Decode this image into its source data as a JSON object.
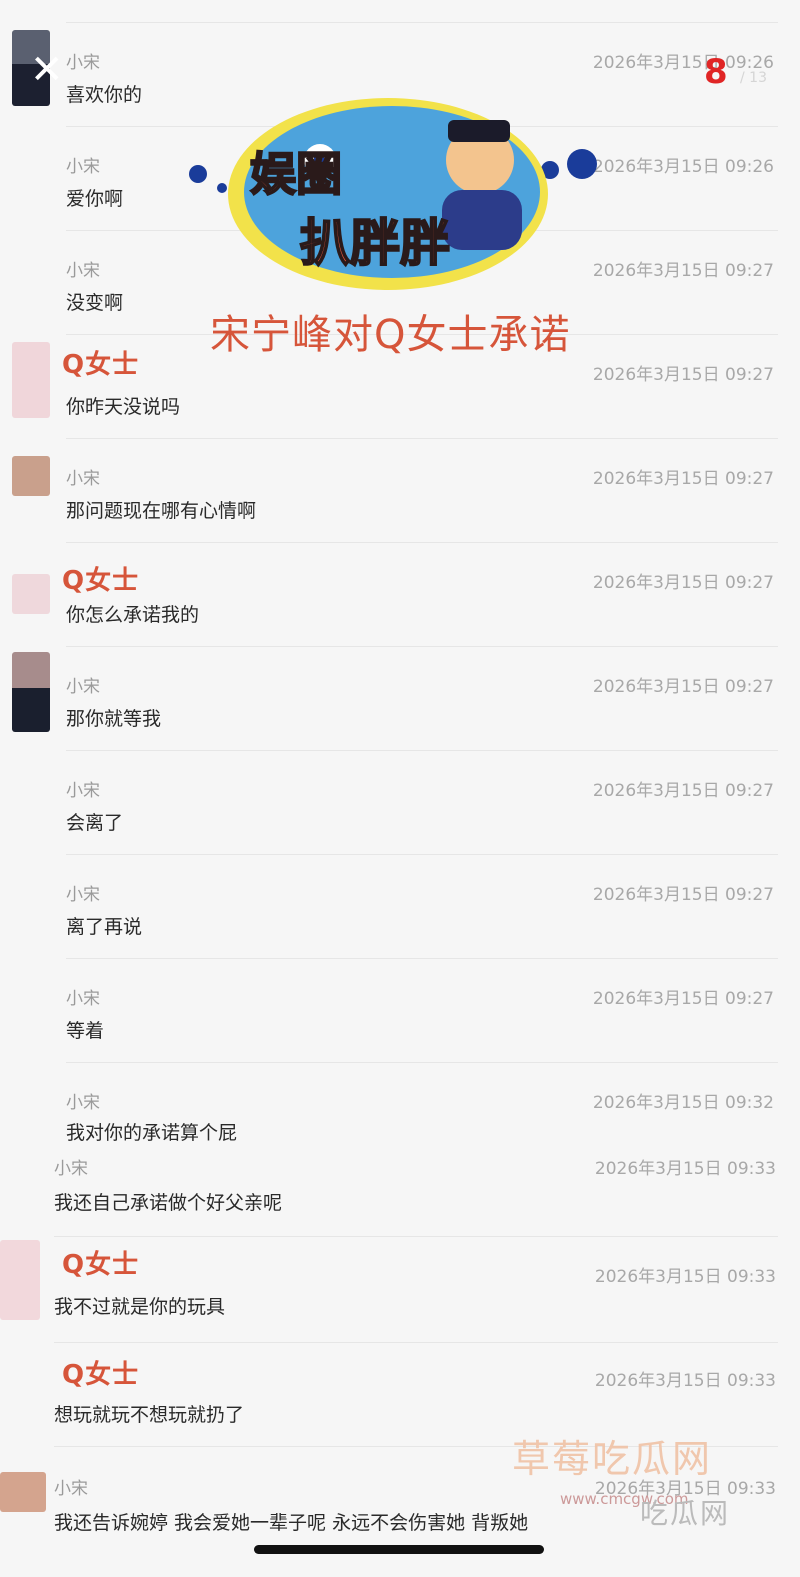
{
  "overlay": {
    "close_symbol": "✕",
    "page_counter": "8",
    "page_total": "/ 13",
    "caption": "宋宁峰对Q女士承诺",
    "logo_text_line1": "娱圈",
    "logo_text_line2": "扒胖胖",
    "watermark": "草莓吃瓜网",
    "watermark_url": "www.cmcgw.com",
    "watermark_2": "吃瓜网",
    "colors": {
      "accent": "#d6553a",
      "counter": "#e02525",
      "logo_ring": "#f2e24a",
      "logo_fill": "#4da3dc",
      "logo_dots": "#1a3c9a"
    }
  },
  "messages": [
    {
      "sender": "小宋",
      "time": "2026年3月15日 09:26",
      "text": "喜欢你的"
    },
    {
      "sender": "小宋",
      "time": "2026年3月15日 09:26",
      "text": "爱你啊"
    },
    {
      "sender": "小宋",
      "time": "2026年3月15日 09:27",
      "text": "没变啊"
    },
    {
      "sender": "Q女士",
      "time": "2026年3月15日 09:27",
      "text": "你昨天没说吗"
    },
    {
      "sender": "小宋",
      "time": "2026年3月15日 09:27",
      "text": "那问题现在哪有心情啊"
    },
    {
      "sender": "Q女士",
      "time": "2026年3月15日 09:27",
      "text": "你怎么承诺我的"
    },
    {
      "sender": "小宋",
      "time": "2026年3月15日 09:27",
      "text": "那你就等我"
    },
    {
      "sender": "小宋",
      "time": "2026年3月15日 09:27",
      "text": "会离了"
    },
    {
      "sender": "小宋",
      "time": "2026年3月15日 09:27",
      "text": "离了再说"
    },
    {
      "sender": "小宋",
      "time": "2026年3月15日 09:27",
      "text": "等着"
    },
    {
      "sender": "小宋",
      "time": "2026年3月15日 09:32",
      "text": "我对你的承诺算个屁"
    },
    {
      "sender": "小宋",
      "time": "2026年3月15日 09:33",
      "text": "我还自己承诺做个好父亲呢"
    },
    {
      "sender": "Q女士",
      "time": "2026年3月15日 09:33",
      "text": "我不过就是你的玩具"
    },
    {
      "sender": "Q女士",
      "time": "2026年3月15日 09:33",
      "text": "想玩就玩不想玩就扔了"
    },
    {
      "sender": "小宋",
      "time": "2026年3月15日 09:33",
      "text": "我还告诉婉婷 我会爱她一辈子呢 永远不会伤害她 背叛她"
    }
  ]
}
